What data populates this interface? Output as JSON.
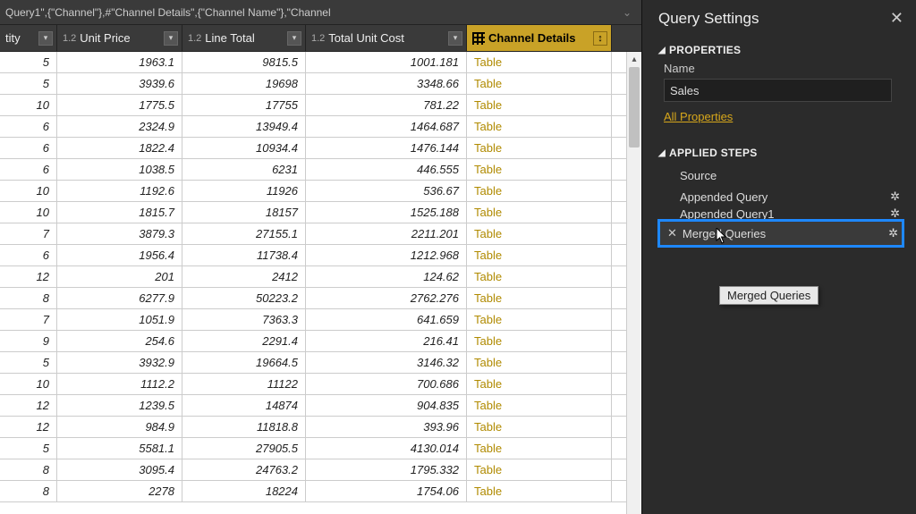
{
  "formula_bar": "Query1\",{\"Channel\"},#\"Channel Details\",{\"Channel Name\"},\"Channel",
  "columns": [
    {
      "type": "",
      "label": "tity"
    },
    {
      "type": "1.2",
      "label": "Unit Price"
    },
    {
      "type": "1.2",
      "label": "Line Total"
    },
    {
      "type": "1.2",
      "label": "Total Unit Cost"
    },
    {
      "type": "grid",
      "label": "Channel Details"
    }
  ],
  "rows": [
    {
      "qty": "5",
      "up": "1963.1",
      "lt": "9815.5",
      "tc": "1001.181",
      "cd": "Table"
    },
    {
      "qty": "5",
      "up": "3939.6",
      "lt": "19698",
      "tc": "3348.66",
      "cd": "Table"
    },
    {
      "qty": "10",
      "up": "1775.5",
      "lt": "17755",
      "tc": "781.22",
      "cd": "Table"
    },
    {
      "qty": "6",
      "up": "2324.9",
      "lt": "13949.4",
      "tc": "1464.687",
      "cd": "Table"
    },
    {
      "qty": "6",
      "up": "1822.4",
      "lt": "10934.4",
      "tc": "1476.144",
      "cd": "Table"
    },
    {
      "qty": "6",
      "up": "1038.5",
      "lt": "6231",
      "tc": "446.555",
      "cd": "Table"
    },
    {
      "qty": "10",
      "up": "1192.6",
      "lt": "11926",
      "tc": "536.67",
      "cd": "Table"
    },
    {
      "qty": "10",
      "up": "1815.7",
      "lt": "18157",
      "tc": "1525.188",
      "cd": "Table"
    },
    {
      "qty": "7",
      "up": "3879.3",
      "lt": "27155.1",
      "tc": "2211.201",
      "cd": "Table"
    },
    {
      "qty": "6",
      "up": "1956.4",
      "lt": "11738.4",
      "tc": "1212.968",
      "cd": "Table"
    },
    {
      "qty": "12",
      "up": "201",
      "lt": "2412",
      "tc": "124.62",
      "cd": "Table"
    },
    {
      "qty": "8",
      "up": "6277.9",
      "lt": "50223.2",
      "tc": "2762.276",
      "cd": "Table"
    },
    {
      "qty": "7",
      "up": "1051.9",
      "lt": "7363.3",
      "tc": "641.659",
      "cd": "Table"
    },
    {
      "qty": "9",
      "up": "254.6",
      "lt": "2291.4",
      "tc": "216.41",
      "cd": "Table"
    },
    {
      "qty": "5",
      "up": "3932.9",
      "lt": "19664.5",
      "tc": "3146.32",
      "cd": "Table"
    },
    {
      "qty": "10",
      "up": "1112.2",
      "lt": "11122",
      "tc": "700.686",
      "cd": "Table"
    },
    {
      "qty": "12",
      "up": "1239.5",
      "lt": "14874",
      "tc": "904.835",
      "cd": "Table"
    },
    {
      "qty": "12",
      "up": "984.9",
      "lt": "11818.8",
      "tc": "393.96",
      "cd": "Table"
    },
    {
      "qty": "5",
      "up": "5581.1",
      "lt": "27905.5",
      "tc": "4130.014",
      "cd": "Table"
    },
    {
      "qty": "8",
      "up": "3095.4",
      "lt": "24763.2",
      "tc": "1795.332",
      "cd": "Table"
    },
    {
      "qty": "8",
      "up": "2278",
      "lt": "18224",
      "tc": "1754.06",
      "cd": "Table"
    }
  ],
  "panel": {
    "title": "Query Settings",
    "properties_label": "PROPERTIES",
    "name_label": "Name",
    "name_value": "Sales",
    "all_properties": "All Properties",
    "applied_steps_label": "APPLIED STEPS",
    "steps": {
      "source": "Source",
      "appended_query": "Appended Query",
      "appended_query1": "Appended Query1",
      "merged_queries": "Merged Queries"
    },
    "tooltip": "Merged Queries"
  }
}
